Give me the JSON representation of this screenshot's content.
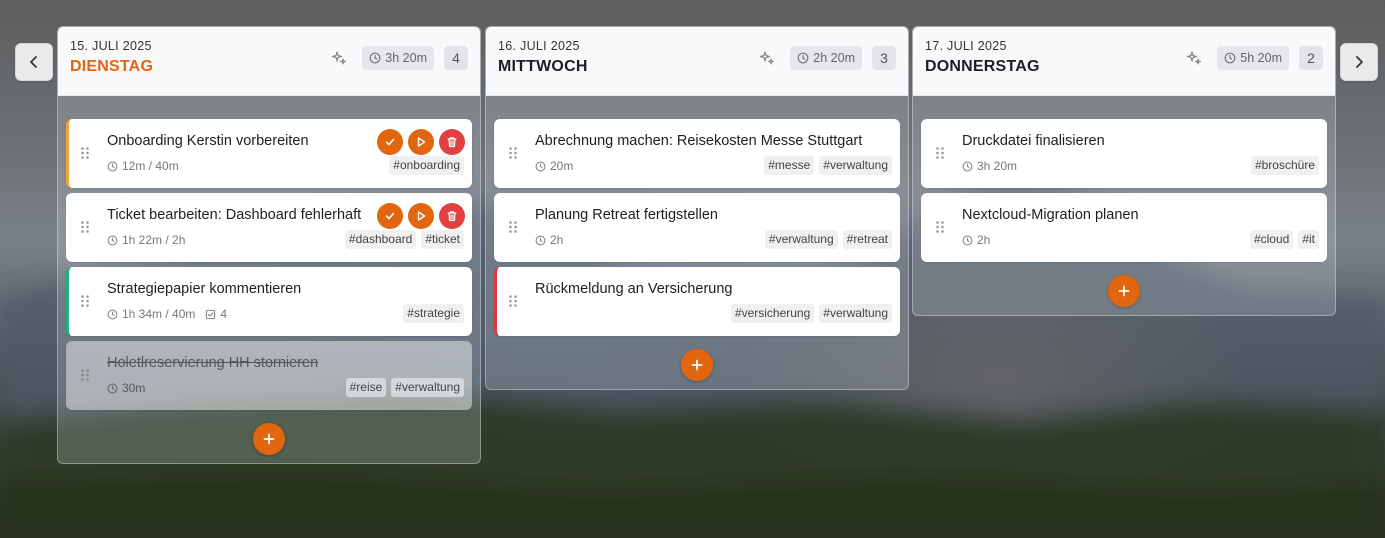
{
  "nav": {
    "prev_icon": "chevron-left-icon",
    "next_icon": "chevron-right-icon"
  },
  "colors": {
    "accent": "#e2650f",
    "danger": "#e04040",
    "today": "#e2650f"
  },
  "columns": [
    {
      "date": "15. JULI 2025",
      "day": "DIENSTAG",
      "duration": "3h 20m",
      "count": "4",
      "tasks": [
        {
          "title": "Onboarding Kerstin vorbereiten",
          "time": "12m / 40m",
          "tags": [
            "#onboarding"
          ]
        },
        {
          "title": "Ticket bearbeiten: Dashboard fehlerhaft",
          "time": "1h 22m / 2h",
          "tags": [
            "#dashboard",
            "#ticket"
          ]
        },
        {
          "title": "Strategiepapier kommentieren",
          "time": "1h 34m / 40m",
          "subtasks": "4",
          "tags": [
            "#strategie"
          ]
        },
        {
          "title": "Holetlreservierung HH stornieren",
          "time": "30m",
          "tags": [
            "#reise",
            "#verwaltung"
          ]
        }
      ]
    },
    {
      "date": "16. JULI 2025",
      "day": "MITTWOCH",
      "duration": "2h 20m",
      "count": "3",
      "tasks": [
        {
          "title": "Abrechnung machen: Reisekosten Messe Stuttgart",
          "time": "20m",
          "tags": [
            "#messe",
            "#verwaltung"
          ]
        },
        {
          "title": "Planung Retreat fertigstellen",
          "time": "2h",
          "tags": [
            "#verwaltung",
            "#retreat"
          ]
        },
        {
          "title": "Rückmeldung an Versicherung",
          "tags": [
            "#versicherung",
            "#verwaltung"
          ]
        }
      ]
    },
    {
      "date": "17. JULI 2025",
      "day": "DONNERSTAG",
      "duration": "5h 20m",
      "count": "2",
      "tasks": [
        {
          "title": "Druckdatei finalisieren",
          "time": "3h 20m",
          "tags": [
            "#broschüre"
          ]
        },
        {
          "title": "Nextcloud-Migration planen",
          "time": "2h",
          "tags": [
            "#cloud",
            "#it"
          ]
        }
      ]
    }
  ]
}
